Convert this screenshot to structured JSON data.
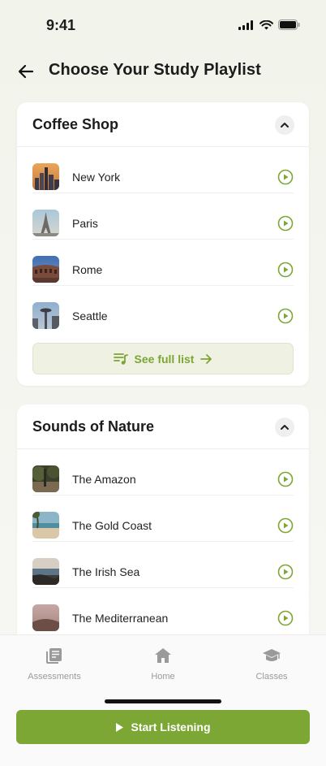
{
  "status_bar": {
    "time": "9:41"
  },
  "header": {
    "title": "Choose Your Study Playlist"
  },
  "coffee_shop": {
    "title": "Coffee Shop",
    "items": [
      {
        "label": "New York",
        "thumb": "city-skyline"
      },
      {
        "label": "Paris",
        "thumb": "eiffel-tower"
      },
      {
        "label": "Rome",
        "thumb": "colosseum"
      },
      {
        "label": "Seattle",
        "thumb": "space-needle"
      }
    ],
    "see_full_list": "See full list"
  },
  "nature": {
    "title": "Sounds of Nature",
    "items": [
      {
        "label": "The Amazon",
        "thumb": "rainforest"
      },
      {
        "label": "The Gold Coast",
        "thumb": "beach"
      },
      {
        "label": "The Irish Sea",
        "thumb": "coastline"
      },
      {
        "label": "The Mediterranean",
        "thumb": "sea-sunset"
      }
    ]
  },
  "tabs": [
    {
      "label": "Assessments",
      "icon": "assessments-icon"
    },
    {
      "label": "Home",
      "icon": "home-icon"
    },
    {
      "label": "Classes",
      "icon": "graduation-cap-icon"
    }
  ],
  "cta": {
    "label": "Start Listening"
  },
  "colors": {
    "accent": "#7ca735",
    "accent_soft": "#eff2e3",
    "background": "#f4f5ef"
  }
}
